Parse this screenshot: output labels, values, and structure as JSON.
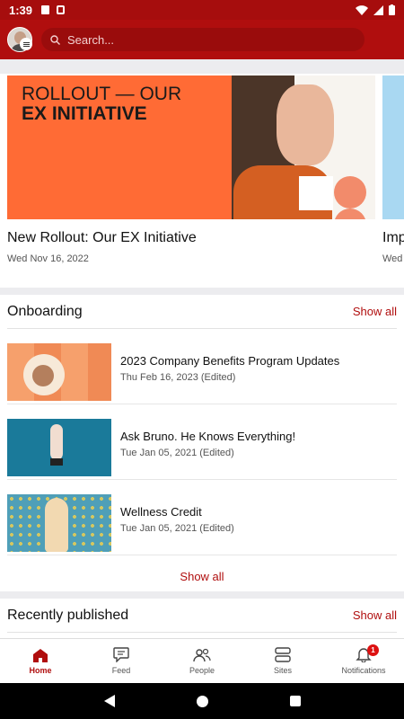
{
  "status": {
    "time": "1:39"
  },
  "header": {
    "search_placeholder": "Search..."
  },
  "hero": {
    "image_line1": "ROLLOUT — OUR",
    "image_line2": "EX INITIATIVE",
    "title": "New Rollout: Our EX Initiative",
    "date": "Wed Nov 16, 2022",
    "peek_title": "Imp",
    "peek_date": "Wed"
  },
  "onboarding": {
    "title": "Onboarding",
    "show_all": "Show all",
    "items": [
      {
        "title": "2023 Company Benefits Program Updates",
        "date": "Thu Feb 16, 2023 (Edited)"
      },
      {
        "title": "Ask Bruno. He Knows Everything!",
        "date": "Tue Jan 05, 2021 (Edited)"
      },
      {
        "title": "Wellness Credit",
        "date": "Tue Jan 05, 2021 (Edited)"
      }
    ],
    "show_all_bottom": "Show all"
  },
  "recent": {
    "title": "Recently published",
    "show_all": "Show all"
  },
  "nav": {
    "items": [
      {
        "label": "Home",
        "icon": "home-icon"
      },
      {
        "label": "Feed",
        "icon": "feed-icon"
      },
      {
        "label": "People",
        "icon": "people-icon"
      },
      {
        "label": "Sites",
        "icon": "sites-icon"
      },
      {
        "label": "Notifications",
        "icon": "bell-icon"
      }
    ],
    "notification_count": "1"
  },
  "colors": {
    "brand": "#b00e0e",
    "hero_bg": "#ff6b35"
  }
}
